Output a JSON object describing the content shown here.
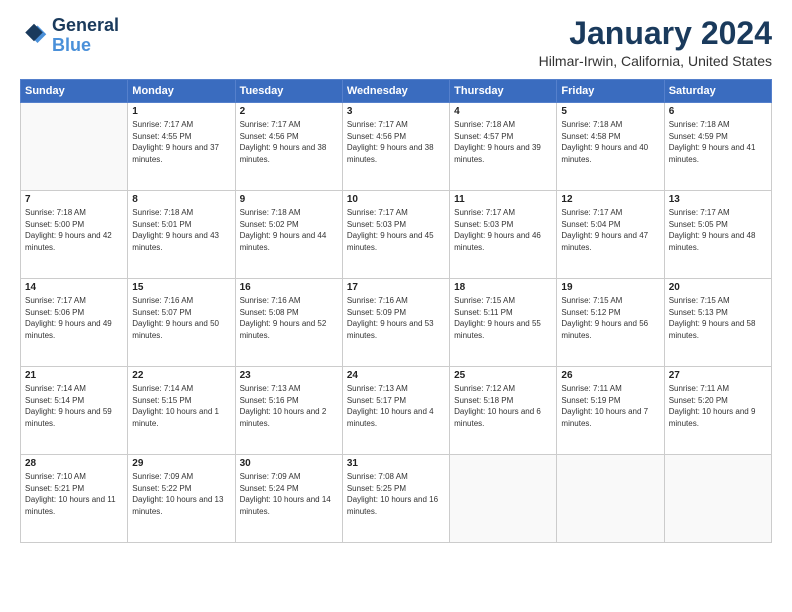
{
  "logo": {
    "line1": "General",
    "line2": "Blue"
  },
  "title": "January 2024",
  "subtitle": "Hilmar-Irwin, California, United States",
  "header_days": [
    "Sunday",
    "Monday",
    "Tuesday",
    "Wednesday",
    "Thursday",
    "Friday",
    "Saturday"
  ],
  "weeks": [
    [
      {
        "day": "",
        "sunrise": "",
        "sunset": "",
        "daylight": ""
      },
      {
        "day": "1",
        "sunrise": "Sunrise: 7:17 AM",
        "sunset": "Sunset: 4:55 PM",
        "daylight": "Daylight: 9 hours and 37 minutes."
      },
      {
        "day": "2",
        "sunrise": "Sunrise: 7:17 AM",
        "sunset": "Sunset: 4:56 PM",
        "daylight": "Daylight: 9 hours and 38 minutes."
      },
      {
        "day": "3",
        "sunrise": "Sunrise: 7:17 AM",
        "sunset": "Sunset: 4:56 PM",
        "daylight": "Daylight: 9 hours and 38 minutes."
      },
      {
        "day": "4",
        "sunrise": "Sunrise: 7:18 AM",
        "sunset": "Sunset: 4:57 PM",
        "daylight": "Daylight: 9 hours and 39 minutes."
      },
      {
        "day": "5",
        "sunrise": "Sunrise: 7:18 AM",
        "sunset": "Sunset: 4:58 PM",
        "daylight": "Daylight: 9 hours and 40 minutes."
      },
      {
        "day": "6",
        "sunrise": "Sunrise: 7:18 AM",
        "sunset": "Sunset: 4:59 PM",
        "daylight": "Daylight: 9 hours and 41 minutes."
      }
    ],
    [
      {
        "day": "7",
        "sunrise": "Sunrise: 7:18 AM",
        "sunset": "Sunset: 5:00 PM",
        "daylight": "Daylight: 9 hours and 42 minutes."
      },
      {
        "day": "8",
        "sunrise": "Sunrise: 7:18 AM",
        "sunset": "Sunset: 5:01 PM",
        "daylight": "Daylight: 9 hours and 43 minutes."
      },
      {
        "day": "9",
        "sunrise": "Sunrise: 7:18 AM",
        "sunset": "Sunset: 5:02 PM",
        "daylight": "Daylight: 9 hours and 44 minutes."
      },
      {
        "day": "10",
        "sunrise": "Sunrise: 7:17 AM",
        "sunset": "Sunset: 5:03 PM",
        "daylight": "Daylight: 9 hours and 45 minutes."
      },
      {
        "day": "11",
        "sunrise": "Sunrise: 7:17 AM",
        "sunset": "Sunset: 5:03 PM",
        "daylight": "Daylight: 9 hours and 46 minutes."
      },
      {
        "day": "12",
        "sunrise": "Sunrise: 7:17 AM",
        "sunset": "Sunset: 5:04 PM",
        "daylight": "Daylight: 9 hours and 47 minutes."
      },
      {
        "day": "13",
        "sunrise": "Sunrise: 7:17 AM",
        "sunset": "Sunset: 5:05 PM",
        "daylight": "Daylight: 9 hours and 48 minutes."
      }
    ],
    [
      {
        "day": "14",
        "sunrise": "Sunrise: 7:17 AM",
        "sunset": "Sunset: 5:06 PM",
        "daylight": "Daylight: 9 hours and 49 minutes."
      },
      {
        "day": "15",
        "sunrise": "Sunrise: 7:16 AM",
        "sunset": "Sunset: 5:07 PM",
        "daylight": "Daylight: 9 hours and 50 minutes."
      },
      {
        "day": "16",
        "sunrise": "Sunrise: 7:16 AM",
        "sunset": "Sunset: 5:08 PM",
        "daylight": "Daylight: 9 hours and 52 minutes."
      },
      {
        "day": "17",
        "sunrise": "Sunrise: 7:16 AM",
        "sunset": "Sunset: 5:09 PM",
        "daylight": "Daylight: 9 hours and 53 minutes."
      },
      {
        "day": "18",
        "sunrise": "Sunrise: 7:15 AM",
        "sunset": "Sunset: 5:11 PM",
        "daylight": "Daylight: 9 hours and 55 minutes."
      },
      {
        "day": "19",
        "sunrise": "Sunrise: 7:15 AM",
        "sunset": "Sunset: 5:12 PM",
        "daylight": "Daylight: 9 hours and 56 minutes."
      },
      {
        "day": "20",
        "sunrise": "Sunrise: 7:15 AM",
        "sunset": "Sunset: 5:13 PM",
        "daylight": "Daylight: 9 hours and 58 minutes."
      }
    ],
    [
      {
        "day": "21",
        "sunrise": "Sunrise: 7:14 AM",
        "sunset": "Sunset: 5:14 PM",
        "daylight": "Daylight: 9 hours and 59 minutes."
      },
      {
        "day": "22",
        "sunrise": "Sunrise: 7:14 AM",
        "sunset": "Sunset: 5:15 PM",
        "daylight": "Daylight: 10 hours and 1 minute."
      },
      {
        "day": "23",
        "sunrise": "Sunrise: 7:13 AM",
        "sunset": "Sunset: 5:16 PM",
        "daylight": "Daylight: 10 hours and 2 minutes."
      },
      {
        "day": "24",
        "sunrise": "Sunrise: 7:13 AM",
        "sunset": "Sunset: 5:17 PM",
        "daylight": "Daylight: 10 hours and 4 minutes."
      },
      {
        "day": "25",
        "sunrise": "Sunrise: 7:12 AM",
        "sunset": "Sunset: 5:18 PM",
        "daylight": "Daylight: 10 hours and 6 minutes."
      },
      {
        "day": "26",
        "sunrise": "Sunrise: 7:11 AM",
        "sunset": "Sunset: 5:19 PM",
        "daylight": "Daylight: 10 hours and 7 minutes."
      },
      {
        "day": "27",
        "sunrise": "Sunrise: 7:11 AM",
        "sunset": "Sunset: 5:20 PM",
        "daylight": "Daylight: 10 hours and 9 minutes."
      }
    ],
    [
      {
        "day": "28",
        "sunrise": "Sunrise: 7:10 AM",
        "sunset": "Sunset: 5:21 PM",
        "daylight": "Daylight: 10 hours and 11 minutes."
      },
      {
        "day": "29",
        "sunrise": "Sunrise: 7:09 AM",
        "sunset": "Sunset: 5:22 PM",
        "daylight": "Daylight: 10 hours and 13 minutes."
      },
      {
        "day": "30",
        "sunrise": "Sunrise: 7:09 AM",
        "sunset": "Sunset: 5:24 PM",
        "daylight": "Daylight: 10 hours and 14 minutes."
      },
      {
        "day": "31",
        "sunrise": "Sunrise: 7:08 AM",
        "sunset": "Sunset: 5:25 PM",
        "daylight": "Daylight: 10 hours and 16 minutes."
      },
      {
        "day": "",
        "sunrise": "",
        "sunset": "",
        "daylight": ""
      },
      {
        "day": "",
        "sunrise": "",
        "sunset": "",
        "daylight": ""
      },
      {
        "day": "",
        "sunrise": "",
        "sunset": "",
        "daylight": ""
      }
    ]
  ]
}
